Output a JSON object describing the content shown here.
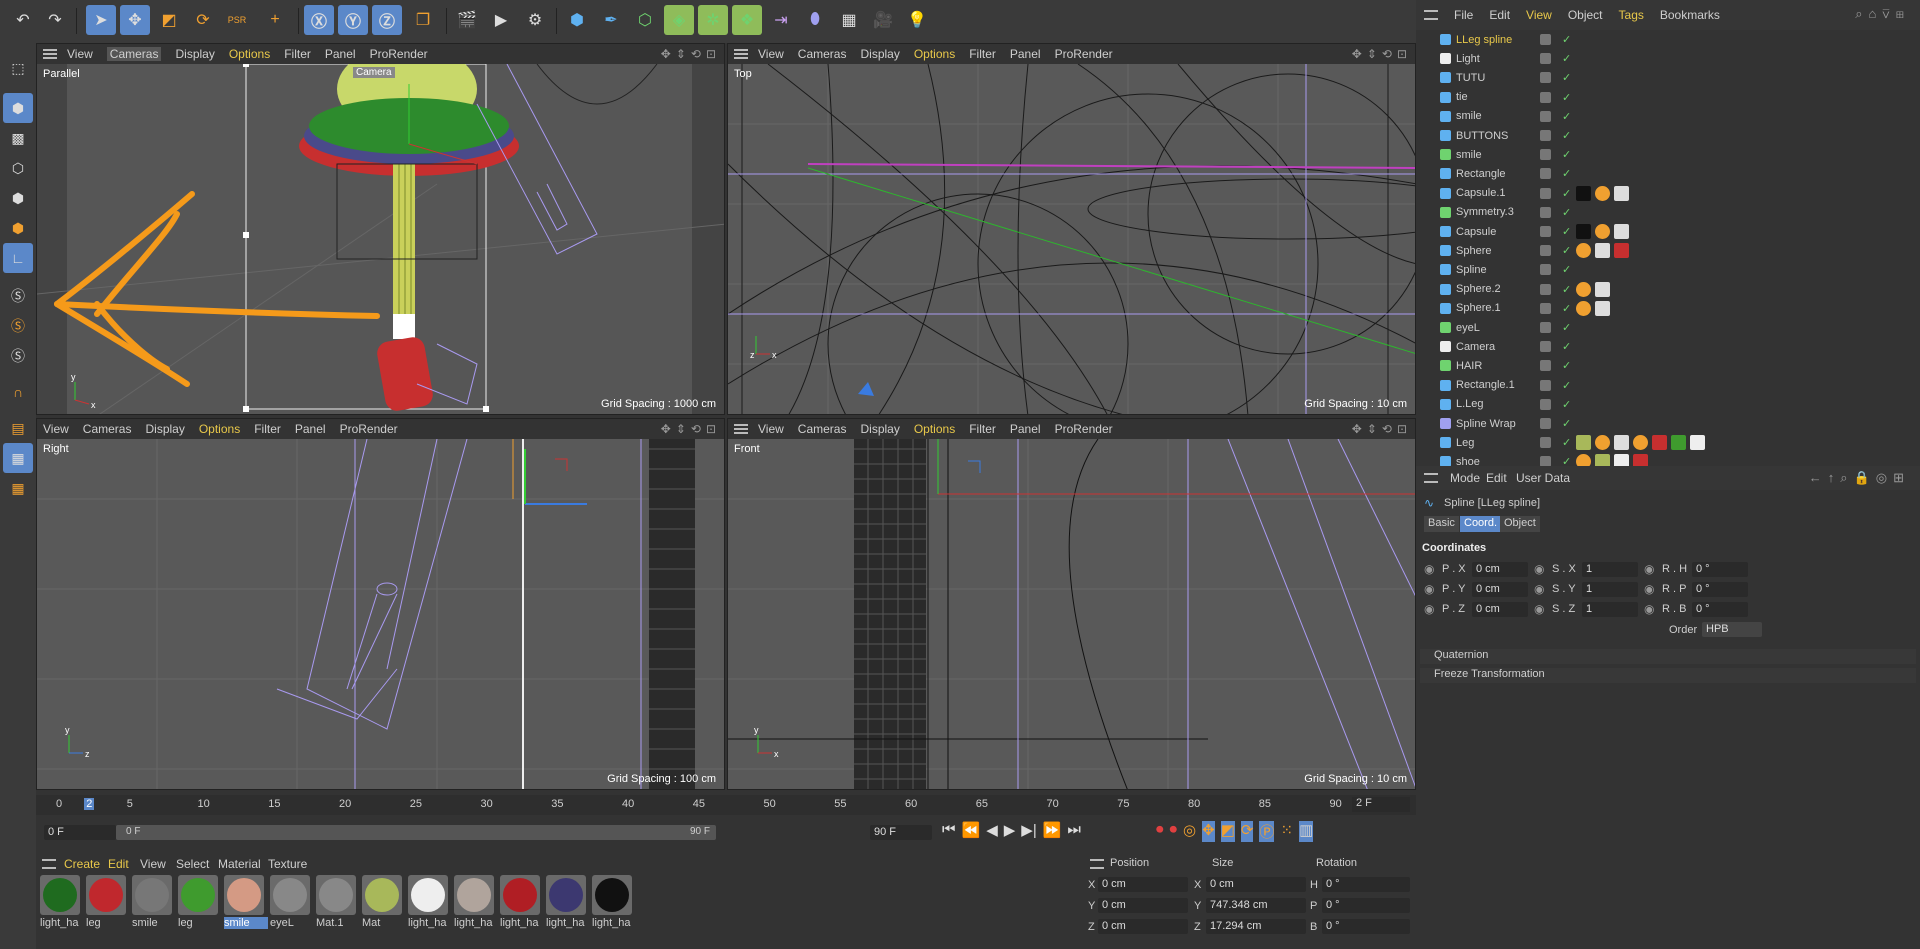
{
  "toolbar": {
    "icons": [
      "undo-icon",
      "redo-icon",
      "select-icon",
      "move-icon",
      "scale-icon",
      "rotate-icon",
      "psr-icon",
      "add-icon",
      "x-axis-icon",
      "y-axis-icon",
      "z-axis-icon",
      "coord-system-icon",
      "render-region-icon",
      "render-view-icon",
      "render-settings-icon",
      "cube-icon",
      "pen-icon",
      "subdivision-icon",
      "generator-icon",
      "cloner-icon",
      "deformer-icon",
      "field-icon",
      "floor-icon",
      "camera-icon",
      "light-icon"
    ]
  },
  "viewports": {
    "perspective": {
      "menu": [
        "View",
        "Cameras",
        "Display",
        "Options",
        "Filter",
        "Panel",
        "ProRender"
      ],
      "label": "Parallel",
      "camera_tag": "Camera",
      "grid": "Grid Spacing : 1000 cm"
    },
    "top": {
      "menu": [
        "View",
        "Cameras",
        "Display",
        "Options",
        "Filter",
        "Panel",
        "ProRender"
      ],
      "label": "Top",
      "grid": "Grid Spacing : 10 cm"
    },
    "right": {
      "menu": [
        "View",
        "Cameras",
        "Display",
        "Options",
        "Filter",
        "Panel",
        "ProRender"
      ],
      "label": "Right",
      "grid": "Grid Spacing : 100 cm"
    },
    "front": {
      "menu": [
        "View",
        "Cameras",
        "Display",
        "Options",
        "Filter",
        "Panel",
        "ProRender"
      ],
      "label": "Front",
      "grid": "Grid Spacing : 10 cm"
    }
  },
  "object_manager": {
    "menu": [
      "File",
      "Edit",
      "View",
      "Object",
      "Tags",
      "Bookmarks"
    ],
    "objects": [
      {
        "name": "LLeg spline",
        "selected": true
      },
      {
        "name": "Light"
      },
      {
        "name": "TUTU"
      },
      {
        "name": "tie"
      },
      {
        "name": "smile"
      },
      {
        "name": "BUTTONS"
      },
      {
        "name": "smile"
      },
      {
        "name": "Rectangle"
      },
      {
        "name": "Capsule.1"
      },
      {
        "name": "Symmetry.3"
      },
      {
        "name": "Capsule"
      },
      {
        "name": "Sphere"
      },
      {
        "name": "Spline"
      },
      {
        "name": "Sphere.2"
      },
      {
        "name": "Sphere.1"
      },
      {
        "name": "eyeL"
      },
      {
        "name": "Camera"
      },
      {
        "name": "HAIR"
      },
      {
        "name": "Rectangle.1"
      },
      {
        "name": "L.Leg"
      },
      {
        "name": "Spline Wrap"
      },
      {
        "name": "Leg"
      },
      {
        "name": "shoe"
      }
    ]
  },
  "attributes": {
    "menu": [
      "Mode",
      "Edit",
      "User Data"
    ],
    "title": "Spline [LLeg spline]",
    "tabs": [
      "Basic",
      "Coord.",
      "Object"
    ],
    "active_tab": "Coord.",
    "section": "Coordinates",
    "rows": [
      {
        "p_label": "P . X",
        "p_val": "0 cm",
        "s_label": "S . X",
        "s_val": "1",
        "r_label": "R . H",
        "r_val": "0 °"
      },
      {
        "p_label": "P . Y",
        "p_val": "0 cm",
        "s_label": "S . Y",
        "s_val": "1",
        "r_label": "R . P",
        "r_val": "0 °"
      },
      {
        "p_label": "P . Z",
        "p_val": "0 cm",
        "s_label": "S . Z",
        "s_val": "1",
        "r_label": "R . B",
        "r_val": "0 °"
      }
    ],
    "order_label": "Order",
    "order_value": "HPB",
    "quaternion": "Quaternion",
    "freeze": "Freeze Transformation"
  },
  "timeline": {
    "ticks": [
      "0",
      "2",
      "5",
      "10",
      "15",
      "20",
      "25",
      "30",
      "35",
      "40",
      "45",
      "50",
      "55",
      "60",
      "65",
      "70",
      "75",
      "80",
      "85",
      "90"
    ],
    "current_frame": "2 F",
    "start_field": "0 F",
    "range_start": "0 F",
    "range_end": "90 F",
    "end_field": "90 F"
  },
  "material_manager": {
    "menu": [
      "Create",
      "Edit",
      "View",
      "Select",
      "Material",
      "Texture"
    ],
    "materials": [
      {
        "label": "light_ha",
        "color": "#1f6b1f"
      },
      {
        "label": "leg",
        "color": "#c0282d"
      },
      {
        "label": "smile",
        "color": "#777"
      },
      {
        "label": "leg",
        "color": "#3f9b2e"
      },
      {
        "label": "smile",
        "color": "#d49a84",
        "selected": true
      },
      {
        "label": "eyeL",
        "color": "#888"
      },
      {
        "label": "Mat.1",
        "color": "#888"
      },
      {
        "label": "Mat",
        "color": "#a8b85a"
      },
      {
        "label": "light_ha",
        "color": "#eeeeee"
      },
      {
        "label": "light_ha",
        "color": "#b0a49c"
      },
      {
        "label": "light_ha",
        "color": "#b01e24"
      },
      {
        "label": "light_ha",
        "color": "#3c3870"
      },
      {
        "label": "light_ha",
        "color": "#111111"
      }
    ]
  },
  "coordinates": {
    "headers": [
      "Position",
      "Size",
      "Rotation"
    ],
    "rows": [
      {
        "axis": "X",
        "pos": "0 cm",
        "size_axis": "X",
        "size": "0 cm",
        "rot_axis": "H",
        "rot": "0 °"
      },
      {
        "axis": "Y",
        "pos": "0 cm",
        "size_axis": "Y",
        "size": "747.348 cm",
        "rot_axis": "P",
        "rot": "0 °"
      },
      {
        "axis": "Z",
        "pos": "0 cm",
        "size_axis": "Z",
        "size": "17.294 cm",
        "rot_axis": "B",
        "rot": "0 °"
      }
    ]
  },
  "colors": {
    "accent": "#5b88c9",
    "highlight_menu": "#e8c84a",
    "check": "#6fd36f"
  }
}
